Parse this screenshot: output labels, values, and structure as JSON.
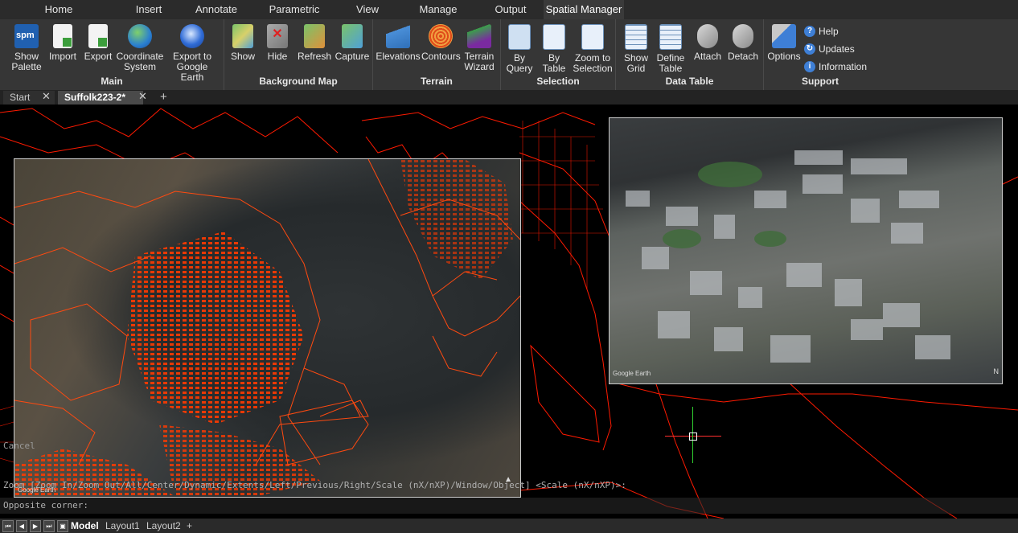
{
  "menu": {
    "tabs": [
      "Home",
      "Insert",
      "Annotate",
      "Parametric",
      "View",
      "Manage",
      "Output",
      "Spatial Manager"
    ],
    "active": "Spatial Manager"
  },
  "ribbon": {
    "main": {
      "title": "Main",
      "show_palette": "Show\nPalette",
      "import": "Import",
      "export": "Export",
      "coordinate_system": "Coordinate\nSystem",
      "export_google_earth": "Export to\nGoogle Earth",
      "spm_label": "spm"
    },
    "background_map": {
      "title": "Background Map",
      "show": "Show",
      "hide": "Hide",
      "refresh": "Refresh",
      "capture": "Capture"
    },
    "terrain": {
      "title": "Terrain",
      "elevations": "Elevations",
      "contours": "Contours",
      "terrain_wizard": "Terrain\nWizard"
    },
    "selection": {
      "title": "Selection",
      "by_query": "By\nQuery",
      "by_table": "By\nTable",
      "zoom_to_selection": "Zoom to\nSelection"
    },
    "data_table": {
      "title": "Data Table",
      "show_grid": "Show\nGrid",
      "define_table": "Define\nTable",
      "attach": "Attach",
      "detach": "Detach"
    },
    "support": {
      "title": "Support",
      "options": "Options",
      "help": "Help",
      "updates": "Updates",
      "information": "Information"
    }
  },
  "doc_tabs": {
    "start": "Start",
    "active": "Suffolk223-2*",
    "add": "+"
  },
  "canvas": {
    "google_earth_label": "Google Earth",
    "north_label": "N"
  },
  "command": {
    "cancel": "Cancel",
    "zoom_prompt": "Zoom [Zoom In/Zoom Out/All/Center/Dynamic/Extents/Left/Previous/Right/Scale (nX/nXP)/Window/Object] <Scale (nX/nXP)>:",
    "opposite_corner": "Opposite corner:"
  },
  "layout_tabs": {
    "model": "Model",
    "layout1": "Layout1",
    "layout2": "Layout2",
    "add": "+"
  },
  "colors": {
    "parcel_lines": "#ff1a00",
    "ribbon_bg": "#363636",
    "menubar_bg": "#2b2b2b",
    "canvas_bg": "#000000"
  }
}
